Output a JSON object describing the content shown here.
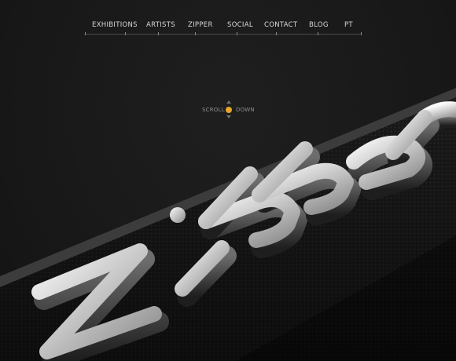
{
  "nav": {
    "items": [
      {
        "label": "EXHIBITIONS"
      },
      {
        "label": "ARTISTS"
      },
      {
        "label": "ZIPPER"
      },
      {
        "label": "SOCIAL"
      },
      {
        "label": "CONTACT"
      },
      {
        "label": "BLOG"
      },
      {
        "label": "PT"
      }
    ]
  },
  "scroll": {
    "left_label": "SCROLL",
    "right_label": "DOWN",
    "dot_color": "#e9a52c"
  },
  "hero": {
    "logo_text": "zipper"
  }
}
